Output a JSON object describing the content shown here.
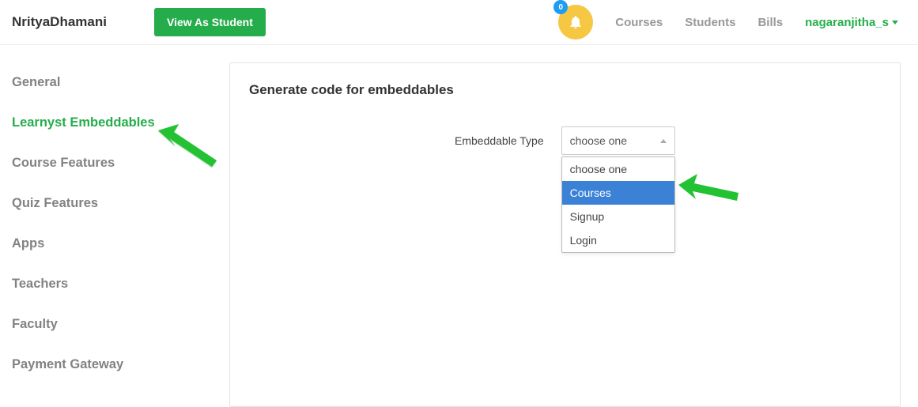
{
  "header": {
    "brand": "NrityaDhamani",
    "view_as_btn": "View As Student",
    "notification_count": "0",
    "nav": {
      "courses": "Courses",
      "students": "Students",
      "bills": "Bills"
    },
    "user": "nagaranjitha_s"
  },
  "sidebar": {
    "items": [
      "General",
      "Learnyst Embeddables",
      "Course Features",
      "Quiz Features",
      "Apps",
      "Teachers",
      "Faculty",
      "Payment Gateway"
    ]
  },
  "panel": {
    "title": "Generate code for embeddables",
    "field_label": "Embeddable Type",
    "select_value": "choose one",
    "options": [
      "choose one",
      "Courses",
      "Signup",
      "Login"
    ],
    "highlighted_index": 1
  }
}
